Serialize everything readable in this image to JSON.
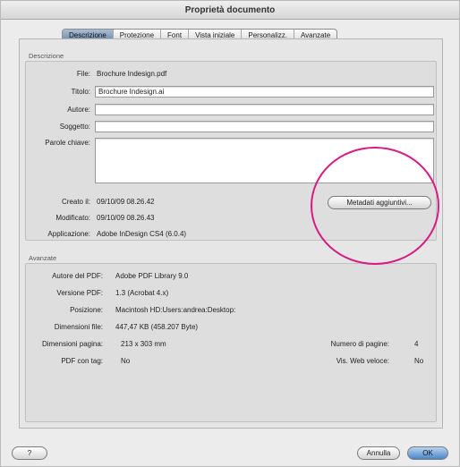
{
  "window": {
    "title": "Proprietà documento"
  },
  "tabs": [
    {
      "label": "Descrizione",
      "active": true
    },
    {
      "label": "Protezione",
      "active": false
    },
    {
      "label": "Font",
      "active": false
    },
    {
      "label": "Vista iniziale",
      "active": false
    },
    {
      "label": "Personalizz.",
      "active": false
    },
    {
      "label": "Avanzate",
      "active": false
    }
  ],
  "description": {
    "section_label": "Descrizione",
    "file_label": "File:",
    "file_value": "Brochure Indesign.pdf",
    "title_label": "Titolo:",
    "title_value": "Brochure Indesign.ai",
    "author_label": "Autore:",
    "author_value": "",
    "subject_label": "Soggetto:",
    "subject_value": "",
    "keywords_label": "Parole chiave:",
    "keywords_value": "",
    "created_label": "Creato il:",
    "created_value": "09/10/09 08.26.42",
    "modified_label": "Modificato:",
    "modified_value": "09/10/09 08.26.43",
    "application_label": "Applicazione:",
    "application_value": "Adobe InDesign CS4 (6.0.4)",
    "metadata_button": "Metadati aggiuntivi..."
  },
  "advanced": {
    "section_label": "Avanzate",
    "pdf_producer_label": "Autore del PDF:",
    "pdf_producer_value": "Adobe PDF Library 9.0",
    "pdf_version_label": "Versione PDF:",
    "pdf_version_value": "1.3 (Acrobat 4.x)",
    "location_label": "Posizione:",
    "location_value": "Macintosh HD:Users:andrea:Desktop:",
    "file_size_label": "Dimensioni file:",
    "file_size_value": "447,47 KB (458.207 Byte)",
    "page_size_label": "Dimensioni pagina:",
    "page_size_value": "213 x 303 mm",
    "page_count_label": "Numero di pagine:",
    "page_count_value": "4",
    "tagged_pdf_label": "PDF con tag:",
    "tagged_pdf_value": "No",
    "fast_web_label": "Vis. Web veloce:",
    "fast_web_value": "No"
  },
  "footer": {
    "help_label": "?",
    "cancel_label": "Annulla",
    "ok_label": "OK"
  },
  "colors": {
    "highlight_circle": "#d81b83",
    "default_button": "#4a86c9"
  }
}
